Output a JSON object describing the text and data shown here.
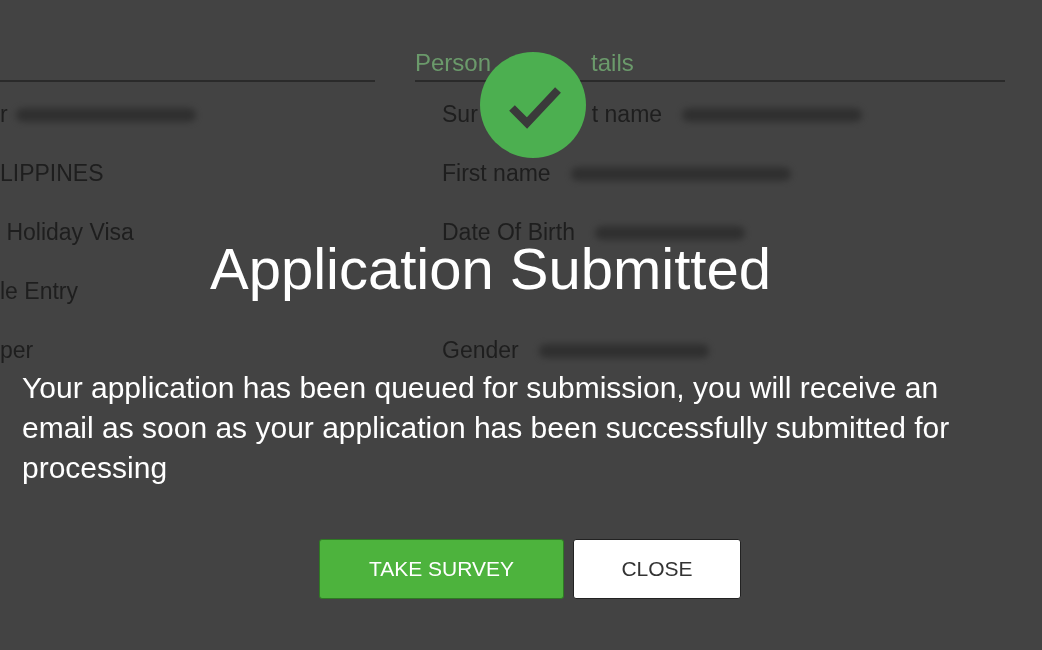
{
  "left_column": {
    "rows": [
      {
        "text": "r",
        "redacted": true
      },
      {
        "text": "LIPPINES",
        "redacted": false
      },
      {
        "text": " Holiday Visa",
        "redacted": false
      },
      {
        "text": "le Entry",
        "redacted": false
      },
      {
        "text": "per",
        "redacted": false
      }
    ]
  },
  "right_column": {
    "heading_parts": [
      "Person",
      "tails"
    ],
    "rows": [
      {
        "label_parts": [
          "Sur",
          "t name"
        ],
        "redacted": true
      },
      {
        "label_parts": [
          "First name"
        ],
        "redacted": true
      },
      {
        "label_parts": [
          "Date Of Birth"
        ],
        "redacted": true
      },
      {
        "label_parts": [
          "Gender"
        ],
        "redacted": true
      }
    ]
  },
  "dialog": {
    "title": "Application Submitted",
    "message": "Your application has been queued for submission, you will receive an email as soon as your application has been successfully submitted for processing",
    "buttons": [
      {
        "label": "TAKE SURVEY",
        "kind": "primary"
      },
      {
        "label": "CLOSE",
        "kind": "secondary"
      }
    ]
  }
}
